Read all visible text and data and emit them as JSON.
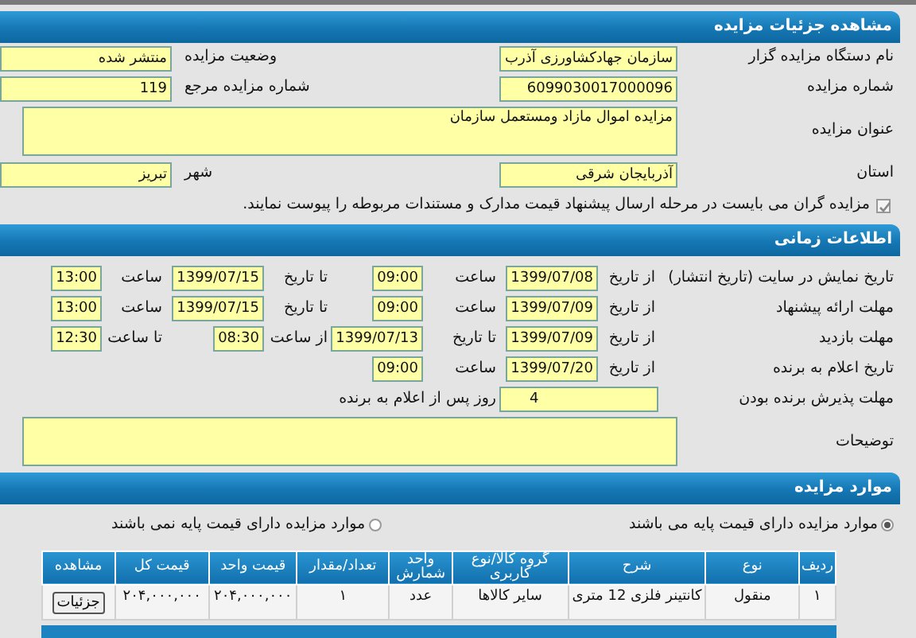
{
  "details": {
    "title": "مشاهده جزئیات مزایده",
    "rows": [
      {
        "kind": "pair",
        "items": [
          {
            "label": "نام دستگاه مزایده گزار",
            "value": "سازمان جهادکشاورزی آذرب"
          },
          {
            "label": "وضعیت مزایده",
            "value": "منتشر شده"
          }
        ]
      },
      {
        "kind": "pair",
        "items": [
          {
            "label": "شماره مزایده",
            "value": "6099030017000096"
          },
          {
            "label": "شماره مزایده مرجع",
            "value": "119"
          }
        ]
      },
      {
        "kind": "area",
        "label": "عنوان مزایده",
        "value": "مزایده اموال مازاد ومستعمل سازمان"
      },
      {
        "kind": "pair",
        "items": [
          {
            "label": "استان",
            "value": "آذربایجان شرقی"
          },
          {
            "label": "شهر",
            "value": "تبریز"
          }
        ]
      }
    ],
    "notice": {
      "checked": true,
      "text": "مزایده گران می بایست در مرحله ارسال پیشنهاد قیمت مدارک و مستندات مربوطه را پیوست نمایند."
    }
  },
  "timing": {
    "title": "اطلاعات زمانی",
    "rows": [
      {
        "kind": "grid",
        "label": "تاریخ نمایش در سایت (تاریخ انتشار)",
        "cells": [
          {
            "kind": "text",
            "text": "از تاریخ"
          },
          {
            "kind": "date",
            "text": "1399/07/08"
          },
          {
            "kind": "text",
            "text": "ساعت"
          },
          {
            "kind": "time",
            "text": "09:00"
          },
          {
            "kind": "text",
            "text": "تا تاریخ"
          },
          {
            "kind": "date",
            "text": "1399/07/15"
          },
          {
            "kind": "text",
            "text": "ساعت"
          },
          {
            "kind": "time",
            "text": "13:00"
          }
        ]
      },
      {
        "kind": "grid",
        "label": "مهلت ارائه پیشنهاد",
        "cells": [
          {
            "kind": "text",
            "text": "از تاریخ"
          },
          {
            "kind": "date",
            "text": "1399/07/09"
          },
          {
            "kind": "text",
            "text": "ساعت"
          },
          {
            "kind": "time",
            "text": "09:00"
          },
          {
            "kind": "text",
            "text": "تا تاریخ"
          },
          {
            "kind": "date",
            "text": "1399/07/15"
          },
          {
            "kind": "text",
            "text": "ساعت"
          },
          {
            "kind": "time",
            "text": "13:00"
          }
        ]
      },
      {
        "kind": "grid",
        "label": "مهلت بازدید",
        "cells": [
          {
            "kind": "text",
            "text": "از تاریخ"
          },
          {
            "kind": "date",
            "text": "1399/07/09"
          },
          {
            "kind": "text",
            "text": "تا تاریخ"
          },
          {
            "kind": "date",
            "text": "1399/07/13"
          },
          {
            "kind": "text",
            "text": "از ساعت"
          },
          {
            "kind": "time",
            "text": "08:30"
          },
          {
            "kind": "text",
            "text": "تا ساعت"
          },
          {
            "kind": "time",
            "text": "12:30"
          }
        ]
      },
      {
        "kind": "grid",
        "label": "تاریخ اعلام به برنده",
        "cells": [
          {
            "kind": "text",
            "text": "از تاریخ"
          },
          {
            "kind": "date",
            "text": "1399/07/20"
          },
          {
            "kind": "text",
            "text": "ساعت"
          },
          {
            "kind": "time",
            "text": "09:00"
          }
        ]
      },
      {
        "kind": "days",
        "label": "مهلت پذیرش برنده بودن",
        "value": "4",
        "suffix": "روز پس از اعلام به برنده"
      },
      {
        "kind": "area",
        "label": "توضیحات"
      }
    ]
  },
  "items": {
    "title": "موارد مزایده",
    "options": [
      {
        "label": "موارد مزایده دارای قیمت پایه می باشند",
        "selected": true
      },
      {
        "label": "موارد مزایده دارای قیمت پایه نمی باشند",
        "selected": false
      }
    ],
    "table": {
      "columns": [
        "ردیف",
        "نوع",
        "شرح",
        "گروه کالا/نوع کاربری",
        "واحد شمارش",
        "تعداد/مقدار",
        "قیمت واحد",
        "قیمت کل",
        "مشاهده"
      ],
      "rows": [
        {
          "cells": [
            "۱",
            "منقول",
            "کانتینر فلزی 12 متری",
            "سایر کالاها",
            "عدد",
            "۱",
            "۲۰۴,۰۰۰,۰۰۰",
            "۲۰۴,۰۰۰,۰۰۰"
          ],
          "action": "جزئیات"
        }
      ]
    }
  }
}
